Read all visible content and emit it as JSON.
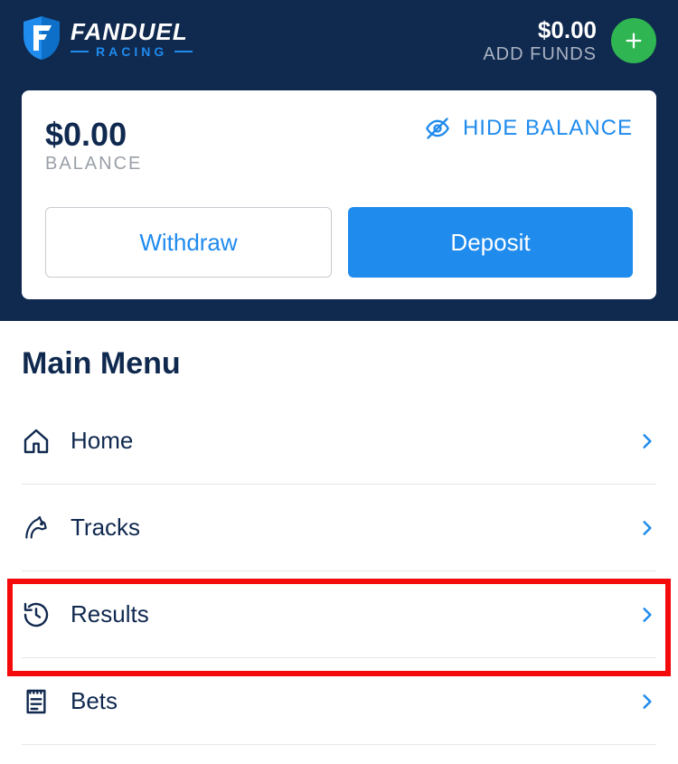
{
  "brand": {
    "name": "FANDUEL",
    "subtitle": "RACING"
  },
  "header": {
    "balance_amount": "$0.00",
    "add_funds_label": "ADD FUNDS"
  },
  "balance_card": {
    "amount": "$0.00",
    "caption": "BALANCE",
    "hide_label": "HIDE BALANCE",
    "withdraw_label": "Withdraw",
    "deposit_label": "Deposit"
  },
  "main": {
    "title": "Main Menu",
    "items": [
      {
        "label": "Home"
      },
      {
        "label": "Tracks"
      },
      {
        "label": "Results"
      },
      {
        "label": "Bets"
      }
    ]
  }
}
